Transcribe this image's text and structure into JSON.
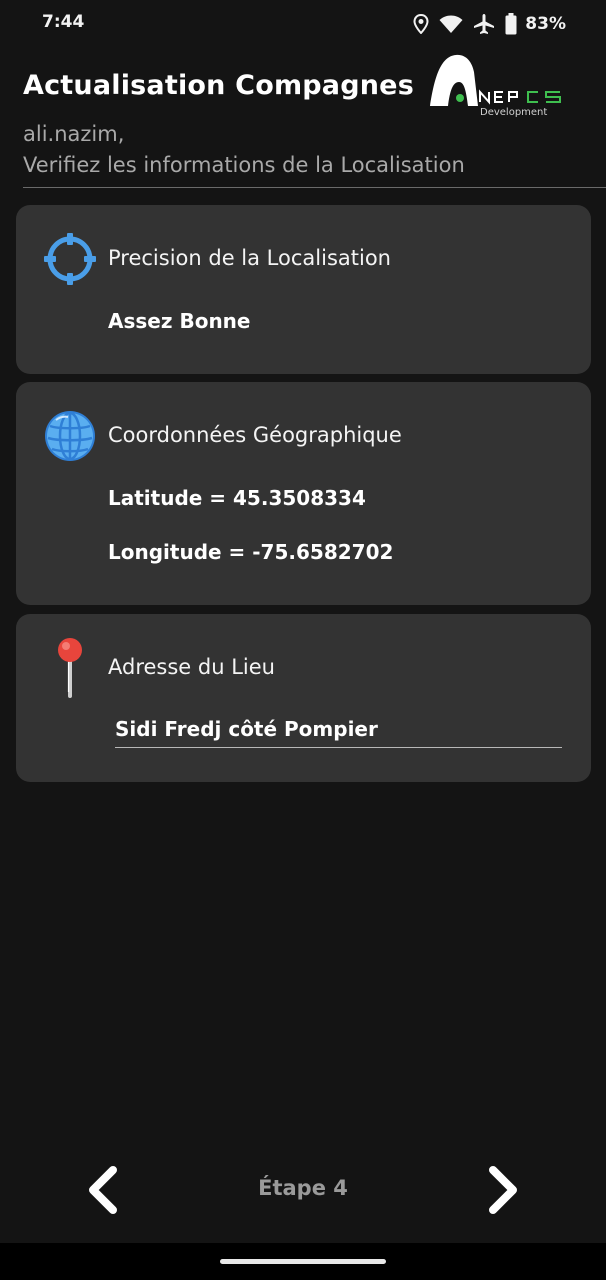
{
  "status_bar": {
    "time": "7:44",
    "battery": "83%",
    "icons": [
      "location-icon",
      "wifi-icon",
      "airplane-icon",
      "battery-icon"
    ]
  },
  "header": {
    "title": "Actualisation Compagnes",
    "logo_text": "NEPCS",
    "logo_subtext": "Development",
    "username": "ali.nazim,",
    "instruction": "Verifiez les informations de la Localisation"
  },
  "precision_card": {
    "icon": "crosshair-icon",
    "label": "Precision de la Localisation",
    "value": "Assez Bonne"
  },
  "coords_card": {
    "icon": "globe-icon",
    "label": "Coordonnées Géographique",
    "latitude": "Latitude = 45.3508334",
    "longitude": "Longitude = -75.6582702"
  },
  "address_card": {
    "icon": "pin-icon",
    "label": "Adresse du Lieu",
    "value": "Sidi Fredj côté Pompier"
  },
  "navigation": {
    "step_label": "Étape 4",
    "prev_icon": "chevron-left-icon",
    "next_icon": "chevron-right-icon"
  },
  "colors": {
    "background": "#141414",
    "card": "#333333",
    "accent_blue": "#4a9ee8",
    "logo_green": "#3fbf4f",
    "pin_red": "#e8453c"
  }
}
